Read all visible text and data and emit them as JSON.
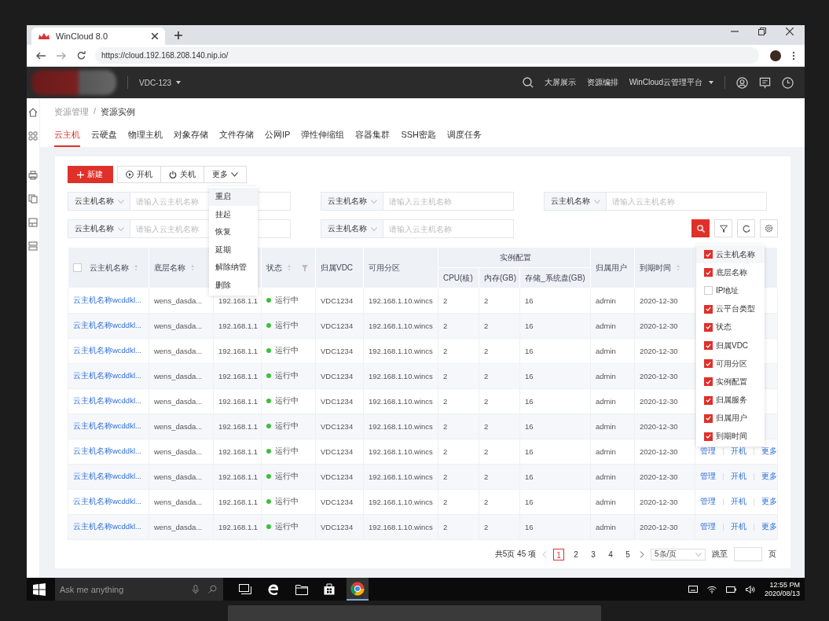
{
  "browser": {
    "tab_title": "WinCloud 8.0",
    "url": "https://cloud.192.168.208.140.nip.io/"
  },
  "header": {
    "vdc": "VDC-123",
    "links": [
      "大屏展示",
      "资源编排"
    ],
    "platform": "WinCloud云管理平台"
  },
  "breadcrumb": {
    "items": [
      "资源管理",
      "资源实例"
    ],
    "separator": "/"
  },
  "tabs": [
    {
      "label": "云主机",
      "selected": true
    },
    {
      "label": "云硬盘",
      "selected": false
    },
    {
      "label": "物理主机",
      "selected": false
    },
    {
      "label": "对象存储",
      "selected": false
    },
    {
      "label": "文件存储",
      "selected": false
    },
    {
      "label": "公网IP",
      "selected": false
    },
    {
      "label": "弹性伸缩组",
      "selected": false
    },
    {
      "label": "容器集群",
      "selected": false
    },
    {
      "label": "SSH密匙",
      "selected": false
    },
    {
      "label": "调度任务",
      "selected": false
    }
  ],
  "toolbar": {
    "new": "新建",
    "start": "开机",
    "stop": "关机",
    "more": "更多"
  },
  "more_menu": [
    {
      "label": "重启",
      "selected": true
    },
    {
      "label": "挂起",
      "selected": false
    },
    {
      "label": "恢复",
      "selected": false
    },
    {
      "label": "延期",
      "selected": false
    },
    {
      "label": "解除纳管",
      "selected": false
    },
    {
      "label": "删除",
      "selected": false
    }
  ],
  "filters": [
    {
      "field": "云主机名称",
      "placeholder": "请输入云主机名称"
    },
    {
      "field": "云主机名称",
      "placeholder": "请输入云主机名称"
    },
    {
      "field": "云主机名称",
      "placeholder": "请输入云主机名称"
    },
    {
      "field": "云主机名称",
      "placeholder": "请输入云主机名称"
    },
    {
      "field": "云主机名称",
      "placeholder": "请输入云主机名称"
    }
  ],
  "table": {
    "select_all": {
      "checked": false
    },
    "columns": [
      "云主机名称",
      "底层名称",
      "",
      "状态",
      "归属VDC",
      "可用分区",
      "实例配置",
      "归属用户",
      "到期时间"
    ],
    "sub_columns": [
      "CPU(核)",
      "内存(GB)",
      "存储_系统盘(GB)"
    ],
    "rows": [
      {
        "name": "云主机名称wcddkl...",
        "host": "wens_dasda...",
        "ip": "192.168.1.1",
        "status": "运行中",
        "vdc": "VDC1234",
        "zone": "192.168.1.10.wincs",
        "cpu": "2",
        "mem": "2",
        "disk": "16",
        "user": "admin",
        "expire": "2020-12-30"
      },
      {
        "name": "云主机名称wcddkl...",
        "host": "wens_dasda...",
        "ip": "192.168.1.1",
        "status": "运行中",
        "vdc": "VDC1234",
        "zone": "192.168.1.10.wincs",
        "cpu": "2",
        "mem": "2",
        "disk": "16",
        "user": "admin",
        "expire": "2020-12-30"
      },
      {
        "name": "云主机名称wcddkl...",
        "host": "wens_dasda...",
        "ip": "192.168.1.1",
        "status": "运行中",
        "vdc": "VDC1234",
        "zone": "192.168.1.10.wincs",
        "cpu": "2",
        "mem": "2",
        "disk": "16",
        "user": "admin",
        "expire": "2020-12-30"
      },
      {
        "name": "云主机名称wcddkl...",
        "host": "wens_dasda...",
        "ip": "192.168.1.1",
        "status": "运行中",
        "vdc": "VDC1234",
        "zone": "192.168.1.10.wincs",
        "cpu": "2",
        "mem": "2",
        "disk": "16",
        "user": "admin",
        "expire": "2020-12-30"
      },
      {
        "name": "云主机名称wcddkl...",
        "host": "wens_dasda...",
        "ip": "192.168.1.1",
        "status": "运行中",
        "vdc": "VDC1234",
        "zone": "192.168.1.10.wincs",
        "cpu": "2",
        "mem": "2",
        "disk": "16",
        "user": "admin",
        "expire": "2020-12-30"
      },
      {
        "name": "云主机名称wcddkl...",
        "host": "wens_dasda...",
        "ip": "192.168.1.1",
        "status": "运行中",
        "vdc": "VDC1234",
        "zone": "192.168.1.10.wincs",
        "cpu": "2",
        "mem": "2",
        "disk": "16",
        "user": "admin",
        "expire": "2020-12-30"
      },
      {
        "name": "云主机名称wcddkl...",
        "host": "wens_dasda...",
        "ip": "192.168.1.1",
        "status": "运行中",
        "vdc": "VDC1234",
        "zone": "192.168.1.10.wincs",
        "cpu": "2",
        "mem": "2",
        "disk": "16",
        "user": "admin",
        "expire": "2020-12-30",
        "actions": [
          "管理",
          "开机",
          "更多"
        ]
      },
      {
        "name": "云主机名称wcddkl...",
        "host": "wens_dasda...",
        "ip": "192.168.1.1",
        "status": "运行中",
        "vdc": "VDC1234",
        "zone": "192.168.1.10.wincs",
        "cpu": "2",
        "mem": "2",
        "disk": "16",
        "user": "admin",
        "expire": "2020-12-30",
        "actions": [
          "管理",
          "开机",
          "更多"
        ]
      },
      {
        "name": "云主机名称wcddkl...",
        "host": "wens_dasda...",
        "ip": "192.168.1.1",
        "status": "运行中",
        "vdc": "VDC1234",
        "zone": "192.168.1.10.wincs",
        "cpu": "2",
        "mem": "2",
        "disk": "16",
        "user": "admin",
        "expire": "2020-12-30",
        "actions": [
          "管理",
          "开机",
          "更多"
        ]
      },
      {
        "name": "云主机名称wcddkl...",
        "host": "wens_dasda...",
        "ip": "192.168.1.1",
        "status": "运行中",
        "vdc": "VDC1234",
        "zone": "192.168.1.10.wincs",
        "cpu": "2",
        "mem": "2",
        "disk": "16",
        "user": "admin",
        "expire": "2020-12-30",
        "actions": [
          "管理",
          "开机",
          "更多"
        ]
      }
    ]
  },
  "column_picker": [
    {
      "label": "云主机名称",
      "checked": true
    },
    {
      "label": "底层名称",
      "checked": true
    },
    {
      "label": "IP地址",
      "checked": false
    },
    {
      "label": "云平台类型",
      "checked": true
    },
    {
      "label": "状态",
      "checked": true
    },
    {
      "label": "归属VDC",
      "checked": true
    },
    {
      "label": "可用分区",
      "checked": true
    },
    {
      "label": "实例配置",
      "checked": true
    },
    {
      "label": "归属服务",
      "checked": true
    },
    {
      "label": "归属用户",
      "checked": true
    },
    {
      "label": "到期时间",
      "checked": true
    }
  ],
  "pagination": {
    "summary": "共5页 45 项",
    "pages": [
      {
        "label": "1",
        "selected": true
      },
      {
        "label": "2",
        "selected": false
      },
      {
        "label": "3",
        "selected": false
      },
      {
        "label": "4",
        "selected": false
      },
      {
        "label": "5",
        "selected": false
      }
    ],
    "page_size": "5条/页",
    "jump_label": "跳至",
    "jump_suffix": "页"
  },
  "taskbar": {
    "search_placeholder": "Ask me anything",
    "time": "12:55 PM",
    "date": "2020/08/13"
  }
}
